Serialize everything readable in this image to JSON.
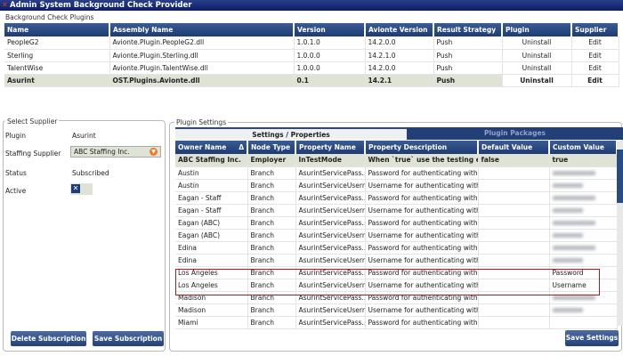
{
  "window": {
    "title": "Admin System Background Check Provider"
  },
  "plugins": {
    "group_label": "Background Check Plugins",
    "columns": [
      "Name",
      "Assembly Name",
      "Version",
      "Avionte Version",
      "Result Strategy",
      "Plugin",
      "Supplier"
    ],
    "rows": [
      {
        "name": "PeopleG2",
        "assembly": "Avionte.Plugin.PeopleG2.dll",
        "version": "1.0.1.0",
        "avionte_version": "14.2.0.0",
        "strategy": "Push",
        "plugin": "Uninstall",
        "supplier": "Edit"
      },
      {
        "name": "Sterling",
        "assembly": "Avionte.Plugin.Sterling.dll",
        "version": "1.0.0.0",
        "avionte_version": "14.2.1.0",
        "strategy": "Push",
        "plugin": "Uninstall",
        "supplier": "Edit"
      },
      {
        "name": "TalentWise",
        "assembly": "Avionte.Plugin.TalentWise.dll",
        "version": "1.0.0.0",
        "avionte_version": "14.2.0.0",
        "strategy": "Push",
        "plugin": "Uninstall",
        "supplier": "Edit"
      },
      {
        "name": "Asurint",
        "assembly": "OST.Plugins.Avionte.dll",
        "version": "0.1",
        "avionte_version": "14.2.1",
        "strategy": "Push",
        "plugin": "Uninstall",
        "supplier": "Edit",
        "selected": true
      }
    ]
  },
  "supplier": {
    "group_label": "Select Supplier",
    "plugin_label": "Plugin",
    "plugin_value": "Asurint",
    "staffing_label": "Staffing Supplier",
    "staffing_value": "ABC Staffing Inc.",
    "status_label": "Status",
    "status_value": "Subscribed",
    "active_label": "Active",
    "active_checked": true,
    "delete_button": "Delete Subscription",
    "save_button": "Save Subscription"
  },
  "settings": {
    "group_label": "Plugin Settings",
    "tabs": [
      "Settings / Properties",
      "Plugin Packages"
    ],
    "active_tab": 0,
    "columns": [
      "Owner Name",
      "Node Type",
      "Property Name",
      "Property Description",
      "Default Value",
      "Custom Value"
    ],
    "sort_indicator": "Δ",
    "rows": [
      {
        "owner": "ABC Staffing Inc.",
        "node": "Employer",
        "prop": "InTestMode",
        "desc": "When `true` use the testing en...",
        "default": "false",
        "custom": "true",
        "selected": true
      },
      {
        "owner": "Austin",
        "node": "Branch",
        "prop": "AsurintServicePass...",
        "desc": "Password for authenticating with...",
        "default": "",
        "custom": "",
        "blurred": true
      },
      {
        "owner": "Austin",
        "node": "Branch",
        "prop": "AsurintServiceUsern...",
        "desc": "Username for authenticating with...",
        "default": "",
        "custom": "",
        "blurred": true
      },
      {
        "owner": "Eagan - Staff",
        "node": "Branch",
        "prop": "AsurintServicePass...",
        "desc": "Password for authenticating with...",
        "default": "",
        "custom": "",
        "blurred": true
      },
      {
        "owner": "Eagan - Staff",
        "node": "Branch",
        "prop": "AsurintServiceUsern...",
        "desc": "Username for authenticating with...",
        "default": "",
        "custom": "",
        "blurred": true
      },
      {
        "owner": "Eagan (ABC)",
        "node": "Branch",
        "prop": "AsurintServicePass...",
        "desc": "Password for authenticating with...",
        "default": "",
        "custom": "",
        "blurred": true
      },
      {
        "owner": "Eagan (ABC)",
        "node": "Branch",
        "prop": "AsurintServiceUsern...",
        "desc": "Username for authenticating with...",
        "default": "",
        "custom": "",
        "blurred": true
      },
      {
        "owner": "Edina",
        "node": "Branch",
        "prop": "AsurintServicePass...",
        "desc": "Password for authenticating with...",
        "default": "",
        "custom": "",
        "blurred": true
      },
      {
        "owner": "Edina",
        "node": "Branch",
        "prop": "AsurintServiceUsern...",
        "desc": "Username for authenticating with...",
        "default": "",
        "custom": "",
        "blurred": true
      },
      {
        "owner": "Los Angeles",
        "node": "Branch",
        "prop": "AsurintServicePass...",
        "desc": "Password for authenticating with...",
        "default": "",
        "custom": "Password"
      },
      {
        "owner": "Los Angeles",
        "node": "Branch",
        "prop": "AsurintServiceUsern...",
        "desc": "Username for authenticating with...",
        "default": "",
        "custom": "Username"
      },
      {
        "owner": "Madison",
        "node": "Branch",
        "prop": "AsurintServicePass...",
        "desc": "Password for authenticating with...",
        "default": "",
        "custom": "",
        "blurred": true
      },
      {
        "owner": "Madison",
        "node": "Branch",
        "prop": "AsurintServiceUsern...",
        "desc": "Username for authenticating with...",
        "default": "",
        "custom": "",
        "blurred": true
      },
      {
        "owner": "Miami",
        "node": "Branch",
        "prop": "AsurintServicePass...",
        "desc": "Password for authenticating with...",
        "default": "",
        "custom": ""
      }
    ],
    "save_button": "Save Settings"
  },
  "colors": {
    "header": "#1e3b73",
    "selected_row": "#dfe3d6",
    "highlight_box": "#b01c22",
    "dropdown": "#f07a2a"
  }
}
